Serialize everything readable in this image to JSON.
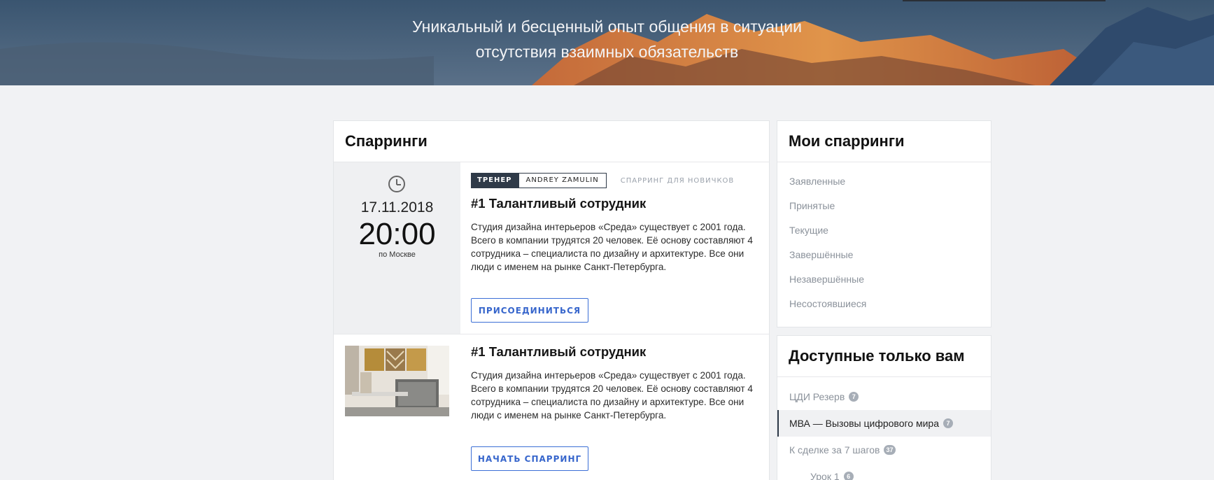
{
  "hero": {
    "subtitle_line1": "Уникальный и бесценный опыт общения в ситуации",
    "subtitle_line2": "отсутствия взаимных обязательств"
  },
  "main": {
    "title": "Спарринги",
    "items": [
      {
        "date": "17.11.2018",
        "time": "20:00",
        "timezone": "по Москве",
        "tag_label": "ТРЕНЕР",
        "trainer": "ANDREY ZAMULIN",
        "level": "СПАРРИНГ ДЛЯ НОВИЧКОВ",
        "title": "#1 Талантливый сотрудник",
        "description": "Студия дизайна интерьеров «Среда» существует с 2001 года. Всего в компании трудятся 20 человек. Её основу составляют 4 сотрудника – специалиста по дизайну и архитектуре. Все они люди с именем на рынке Санкт-Петербурга.",
        "button": "ПРИСОЕДИНИТЬСЯ"
      },
      {
        "title": "#1 Талантливый сотрудник",
        "description": "Студия дизайна интерьеров «Среда» существует с 2001 года. Всего в компании трудятся 20 человек. Её основу составляют 4 сотрудника – специалиста по дизайну и архитектуре. Все они люди с именем на рынке Санкт-Петербурга.",
        "button": "НАЧАТЬ СПАРРИНГ"
      }
    ]
  },
  "my_sparrings": {
    "title": "Мои спарринги",
    "items": [
      "Заявленные",
      "Принятые",
      "Текущие",
      "Завершённые",
      "Незавершённые",
      "Несостоявшиеся"
    ]
  },
  "available": {
    "title": "Доступные только вам",
    "items": [
      {
        "label": "ЦДИ Резерв",
        "badge": "7"
      },
      {
        "label": "МВА — Вызовы цифрового мира",
        "badge": "7"
      },
      {
        "label": "К сделке за 7 шагов",
        "badge": "37"
      },
      {
        "label": "Урок 1",
        "badge": "6"
      }
    ]
  },
  "colors": {
    "accent": "#3766cc",
    "dark": "#2f3a48",
    "background": "#f1f2f4"
  }
}
